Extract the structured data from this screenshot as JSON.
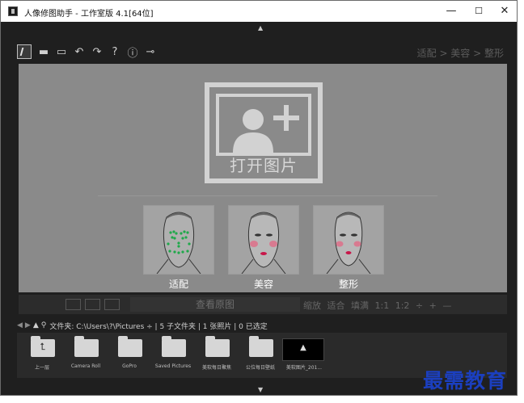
{
  "window": {
    "title": "人像修图助手 - 工作室版 4.1[64位]",
    "minimize_glyph": "—",
    "maximize_glyph": "☐",
    "close_glyph": "✕"
  },
  "toolbar": {
    "icons": [
      "logo-icon",
      "open-folder-icon",
      "save-icon",
      "undo-icon",
      "redo-icon",
      "help-icon",
      "info-icon",
      "plugin-icon"
    ],
    "open_glyph": "▬",
    "save_glyph": "▭",
    "undo_glyph": "↶",
    "redo_glyph": "↷",
    "help_glyph": "?",
    "info_glyph": "ⓘ",
    "plugin_glyph": "⊸"
  },
  "breadcrumb": {
    "text": "适配 > 美容 > 整形"
  },
  "open_image": {
    "label": "打开图片"
  },
  "modes": [
    {
      "label": "适配"
    },
    {
      "label": "美容"
    },
    {
      "label": "整形"
    }
  ],
  "bottombar": {
    "view_original": "查看原图",
    "zoom_text": "缩放  适合  填满  1:1  1:2 ÷  +  —"
  },
  "pathbar": {
    "text": "文件夹: C:\\Users\\?\\Pictures ÷ | 5 子文件夹 | 1 张照片 | 0 已选定"
  },
  "files": [
    {
      "label": "上一层",
      "type": "up"
    },
    {
      "label": "Camera Roll",
      "type": "folder"
    },
    {
      "label": "GoPro",
      "type": "folder"
    },
    {
      "label": "Saved Pictures",
      "type": "folder"
    },
    {
      "label": "美软每日聚焦",
      "type": "folder"
    },
    {
      "label": "公位每日壁纸",
      "type": "folder"
    },
    {
      "label": "美软图片_201...",
      "type": "photo"
    }
  ],
  "watermark": {
    "text": "最需教育"
  },
  "colors": {
    "canvas": "#8a8a8a",
    "face_green": "#1fa84a",
    "face_pink": "#e06a86",
    "watermark_blue": "#1b3fbf"
  }
}
